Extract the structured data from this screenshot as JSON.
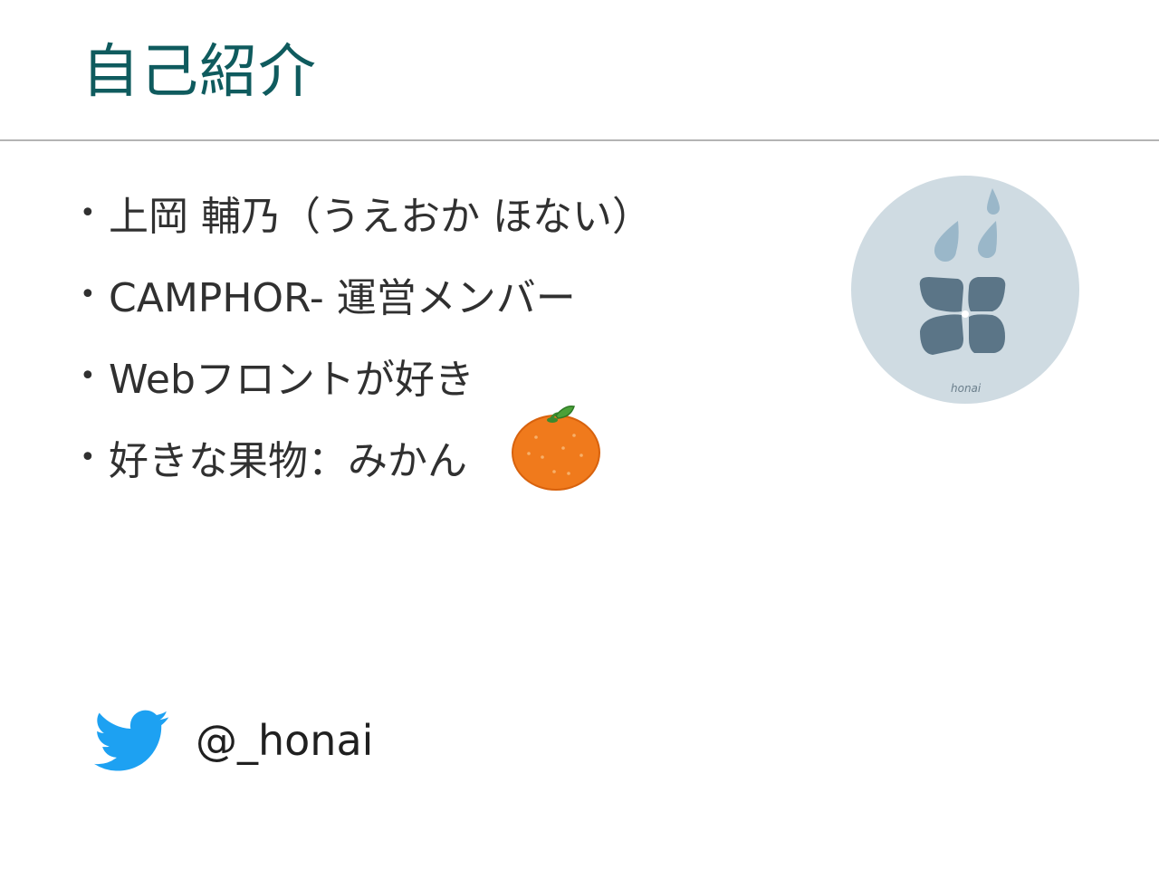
{
  "slide": {
    "title": "自己紹介",
    "bullets": [
      "上岡 輔乃（うえおか ほない）",
      "CAMPHOR- 運営メンバー",
      "Webフロントが好き",
      "好きな果物：みかん"
    ],
    "avatar": {
      "caption": "honai"
    },
    "twitter": {
      "icon": "twitter-bird-icon",
      "handle": "@_honai"
    },
    "colors": {
      "title": "#0f5b5e",
      "text": "#303030",
      "rule": "#b4b4b4",
      "twitter_blue": "#1da1f2",
      "avatar_bg": "#cfdbe2",
      "petal": "#5b7587",
      "drop": "#9ab7c9",
      "orange": "#f07a1c"
    }
  }
}
